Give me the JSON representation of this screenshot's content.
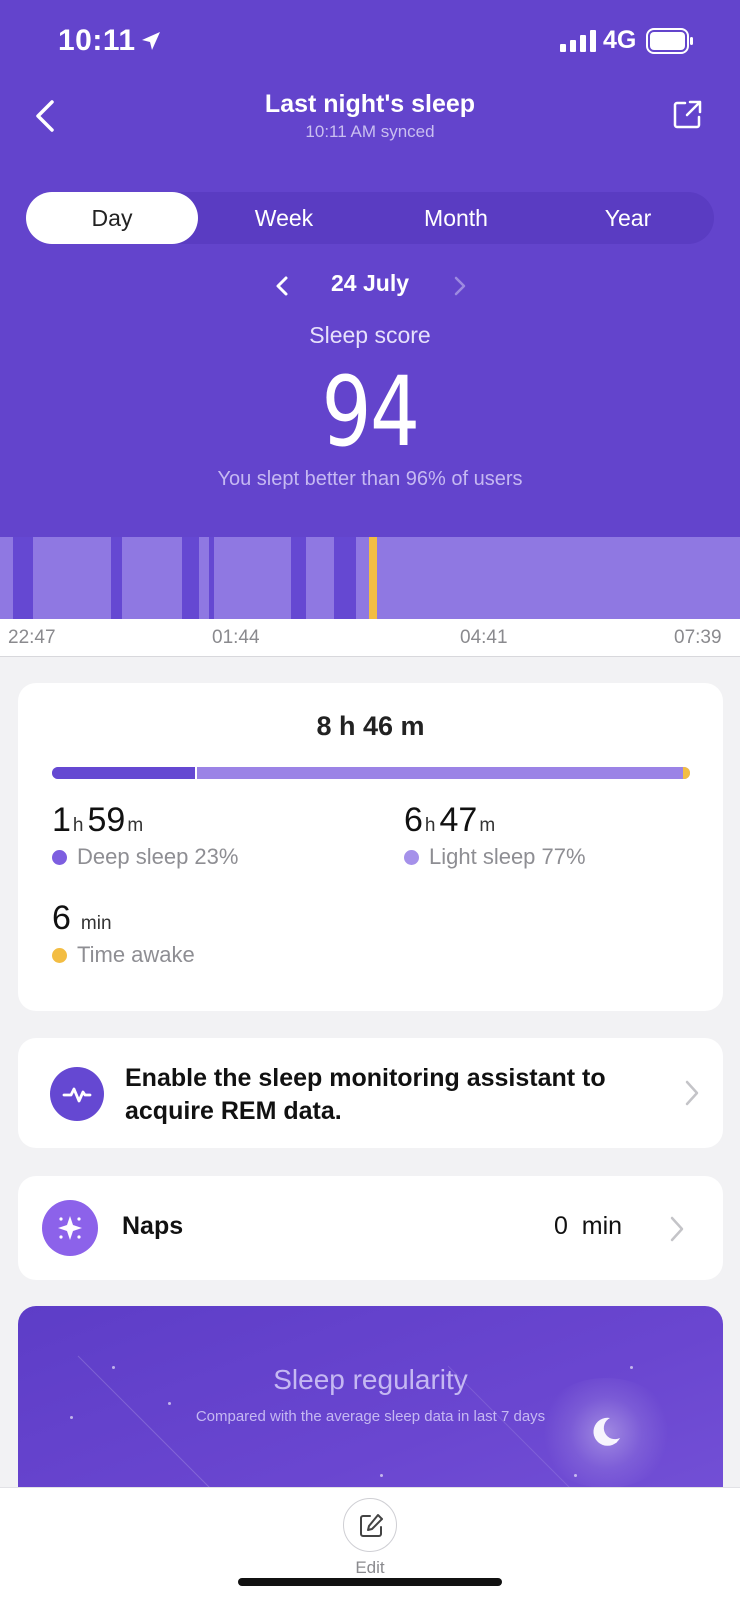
{
  "status_bar": {
    "time": "10:11",
    "network": "4G"
  },
  "nav": {
    "title": "Last night's sleep",
    "subtitle": "10:11 AM synced"
  },
  "tabs": [
    {
      "label": "Day",
      "active": true
    },
    {
      "label": "Week",
      "active": false
    },
    {
      "label": "Month",
      "active": false
    },
    {
      "label": "Year",
      "active": false
    }
  ],
  "date": {
    "label": "24 July"
  },
  "score": {
    "label": "Sleep score",
    "value": "94",
    "compare": "You slept better than 96% of users"
  },
  "timeline": {
    "ticks": [
      "22:47",
      "01:44",
      "04:41",
      "07:39"
    ],
    "stages": [
      {
        "stage": "light",
        "from": "22:47",
        "to": "22:56"
      },
      {
        "stage": "deep",
        "from": "22:56",
        "to": "23:11"
      },
      {
        "stage": "light",
        "from": "23:11",
        "to": "00:07"
      },
      {
        "stage": "deep",
        "from": "00:07",
        "to": "00:15"
      },
      {
        "stage": "light",
        "from": "00:15",
        "to": "00:58"
      },
      {
        "stage": "deep",
        "from": "00:58",
        "to": "01:10"
      },
      {
        "stage": "light",
        "from": "01:10",
        "to": "01:17"
      },
      {
        "stage": "deep",
        "from": "01:17",
        "to": "01:21"
      },
      {
        "stage": "light",
        "from": "01:21",
        "to": "02:16"
      },
      {
        "stage": "deep",
        "from": "02:16",
        "to": "02:27"
      },
      {
        "stage": "light",
        "from": "02:27",
        "to": "02:47"
      },
      {
        "stage": "deep",
        "from": "02:47",
        "to": "03:03"
      },
      {
        "stage": "light",
        "from": "03:03",
        "to": "03:12"
      },
      {
        "stage": "awake",
        "from": "03:12",
        "to": "03:15"
      },
      {
        "stage": "light",
        "from": "03:15",
        "to": "07:39"
      }
    ],
    "colors": {
      "light": "#8f78e2",
      "deep": "#6548d2",
      "awake": "#f3bd43"
    }
  },
  "summary": {
    "total": "8 h 46 m",
    "deep": {
      "hours": "1",
      "h_unit": "h",
      "minutes": "59",
      "m_unit": "m",
      "label": "Deep sleep 23%",
      "percent": 23,
      "color": "#6548d2"
    },
    "light": {
      "hours": "6",
      "h_unit": "h",
      "minutes": "47",
      "m_unit": "m",
      "label": "Light sleep 77%",
      "percent": 77,
      "color": "#9b83e6"
    },
    "awake": {
      "minutes": "6",
      "unit": "min",
      "label": "Time awake",
      "color": "#f3bd43"
    }
  },
  "rem_prompt": {
    "text": "Enable the sleep monitoring assistant to acquire REM data."
  },
  "naps": {
    "label": "Naps",
    "value": "0  min"
  },
  "regularity": {
    "title": "Sleep regularity",
    "subtitle": "Compared with the average sleep data in last 7 days"
  },
  "bottom": {
    "edit_label": "Edit"
  },
  "icons": {
    "back": "back-chevron-icon",
    "share": "share-icon",
    "rem": "heartbeat-icon",
    "naps": "sparkle-icon",
    "moon": "moon-icon",
    "edit": "edit-icon"
  }
}
